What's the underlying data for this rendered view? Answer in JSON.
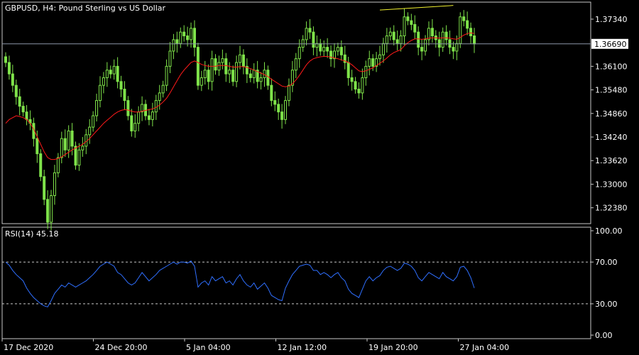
{
  "window": {
    "title": "GBPUSD, H4:  Pound Sterling vs US Dollar",
    "indicator_title": "RSI(14) 45.18"
  },
  "colors": {
    "background": "#000000",
    "frame": "#c8c8c8",
    "candle": "#7fe34a",
    "moving_average": "#ff1a1a",
    "rsi_line": "#2f6fff",
    "trendline": "#f2f230",
    "current_price_line": "#8c96a8",
    "text": "#ffffff"
  },
  "chart_data": [
    {
      "type": "candlestick",
      "symbol": "GBPUSD",
      "timeframe": "H4",
      "title": "GBPUSD, H4:  Pound Sterling vs US Dollar",
      "ylim": [
        1.32,
        1.3775
      ],
      "y_ticks": [
        "1.37340",
        "1.36100",
        "1.35480",
        "1.34860",
        "1.34240",
        "1.33620",
        "1.33000",
        "1.32380"
      ],
      "x_ticks": [
        "17 Dec 2020",
        "24 Dec 20:00",
        "5 Jan 04:00",
        "12 Jan 12:00",
        "19 Jan 20:00",
        "27 Jan 04:00"
      ],
      "current_price": "1.36690",
      "series_close": [
        1.362,
        1.359,
        1.356,
        1.353,
        1.3505,
        1.349,
        1.347,
        1.346,
        1.342,
        1.338,
        1.332,
        1.326,
        1.32,
        1.327,
        1.333,
        1.337,
        1.342,
        1.339,
        1.344,
        1.34,
        1.335,
        1.339,
        1.34,
        1.343,
        1.345,
        1.348,
        1.352,
        1.356,
        1.358,
        1.36,
        1.359,
        1.361,
        1.357,
        1.355,
        1.352,
        1.348,
        1.344,
        1.346,
        1.349,
        1.351,
        1.348,
        1.347,
        1.349,
        1.352,
        1.354,
        1.356,
        1.361,
        1.365,
        1.368,
        1.367,
        1.37,
        1.369,
        1.368,
        1.371,
        1.366,
        1.356,
        1.358,
        1.36,
        1.357,
        1.363,
        1.36,
        1.362,
        1.363,
        1.359,
        1.36,
        1.357,
        1.362,
        1.364,
        1.361,
        1.359,
        1.358,
        1.36,
        1.357,
        1.358,
        1.36,
        1.356,
        1.352,
        1.351,
        1.349,
        1.347,
        1.352,
        1.356,
        1.36,
        1.363,
        1.366,
        1.368,
        1.371,
        1.37,
        1.366,
        1.367,
        1.365,
        1.366,
        1.365,
        1.363,
        1.365,
        1.366,
        1.364,
        1.362,
        1.358,
        1.357,
        1.355,
        1.354,
        1.358,
        1.361,
        1.363,
        1.361,
        1.363,
        1.364,
        1.367,
        1.369,
        1.37,
        1.368,
        1.367,
        1.369,
        1.374,
        1.373,
        1.372,
        1.37,
        1.366,
        1.365,
        1.368,
        1.371,
        1.369,
        1.368,
        1.366,
        1.37,
        1.368,
        1.366,
        1.365,
        1.367,
        1.374,
        1.373,
        1.371,
        1.369,
        1.3669
      ],
      "moving_average": [
        1.346,
        1.347,
        1.3475,
        1.348,
        1.3478,
        1.3475,
        1.347,
        1.346,
        1.3445,
        1.3425,
        1.3405,
        1.3385,
        1.337,
        1.3365,
        1.3365,
        1.3368,
        1.3372,
        1.3378,
        1.3384,
        1.339,
        1.3395,
        1.34,
        1.3405,
        1.3412,
        1.342,
        1.343,
        1.344,
        1.345,
        1.346,
        1.3468,
        1.3476,
        1.3484,
        1.349,
        1.3494,
        1.3496,
        1.3495,
        1.3492,
        1.349,
        1.349,
        1.3492,
        1.3494,
        1.3496,
        1.3498,
        1.3502,
        1.3508,
        1.3516,
        1.3526,
        1.354,
        1.3556,
        1.3572,
        1.3588,
        1.36,
        1.361,
        1.362,
        1.3624,
        1.362,
        1.3615,
        1.3612,
        1.361,
        1.361,
        1.361,
        1.3612,
        1.3612,
        1.3612,
        1.361,
        1.3608,
        1.3608,
        1.3609,
        1.3609,
        1.3607,
        1.3604,
        1.36,
        1.3596,
        1.3592,
        1.3588,
        1.3583,
        1.3576,
        1.357,
        1.3564,
        1.3558,
        1.3556,
        1.3558,
        1.3564,
        1.3574,
        1.3586,
        1.36,
        1.3614,
        1.3624,
        1.363,
        1.3633,
        1.3635,
        1.3636,
        1.3636,
        1.3634,
        1.3632,
        1.363,
        1.3627,
        1.3624,
        1.362,
        1.3614,
        1.3606,
        1.3598,
        1.3596,
        1.3598,
        1.3602,
        1.3606,
        1.3612,
        1.3618,
        1.3624,
        1.3632,
        1.364,
        1.3646,
        1.365,
        1.3654,
        1.3664,
        1.3672,
        1.3678,
        1.3682,
        1.3682,
        1.3681,
        1.3682,
        1.3684,
        1.3685,
        1.3685,
        1.3684,
        1.3685,
        1.3685,
        1.3684,
        1.3682,
        1.3681,
        1.3686,
        1.3692,
        1.3696,
        1.3698,
        1.3696
      ]
    },
    {
      "type": "line",
      "title": "RSI(14) 45.18",
      "ylim": [
        0,
        100
      ],
      "y_ticks": [
        "100.00",
        "70.00",
        "30.00",
        "0.00"
      ],
      "levels": [
        70,
        30
      ],
      "values": [
        70,
        67,
        62,
        58,
        55,
        52,
        45,
        40,
        36,
        33,
        30,
        28,
        27,
        33,
        40,
        44,
        48,
        46,
        50,
        48,
        46,
        48,
        50,
        52,
        55,
        58,
        62,
        66,
        68,
        70,
        68,
        66,
        60,
        58,
        54,
        50,
        48,
        50,
        55,
        60,
        56,
        52,
        55,
        58,
        62,
        64,
        66,
        68,
        70,
        68,
        70,
        70,
        69,
        71,
        66,
        46,
        50,
        52,
        48,
        56,
        52,
        54,
        56,
        50,
        52,
        48,
        54,
        58,
        52,
        48,
        46,
        50,
        44,
        47,
        50,
        45,
        38,
        36,
        34,
        33,
        45,
        52,
        58,
        62,
        66,
        67,
        68,
        67,
        62,
        62,
        58,
        60,
        58,
        55,
        58,
        60,
        55,
        52,
        44,
        40,
        38,
        36,
        44,
        52,
        56,
        52,
        55,
        57,
        62,
        65,
        66,
        64,
        62,
        64,
        69,
        68,
        66,
        62,
        55,
        52,
        56,
        60,
        58,
        56,
        54,
        60,
        56,
        54,
        52,
        56,
        65,
        66,
        62,
        55,
        45.18
      ]
    }
  ]
}
